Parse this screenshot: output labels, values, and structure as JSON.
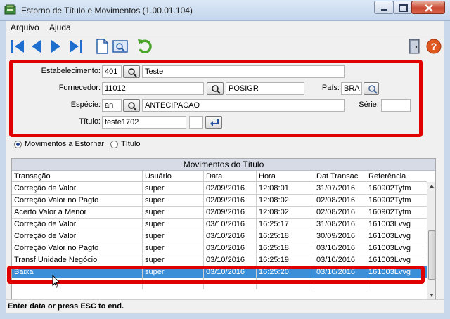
{
  "window": {
    "title": "Estorno de Título e Movimentos (1.00.01.104)"
  },
  "menu": [
    "Arquivo",
    "Ajuda"
  ],
  "toolbar": {
    "icons": [
      "first-record-icon",
      "previous-record-icon",
      "next-record-icon",
      "last-record-icon",
      "new-document-icon",
      "preview-icon",
      "refresh-icon",
      "exit-door-icon",
      "help-icon"
    ]
  },
  "form": {
    "estabelecimento": {
      "label": "Estabelecimento:",
      "code": "401",
      "desc": "Teste"
    },
    "fornecedor": {
      "label": "Fornecedor:",
      "code": "11012",
      "desc": "POSIGR"
    },
    "pais": {
      "label": "País:",
      "value": "BRA"
    },
    "especie": {
      "label": "Espécie:",
      "code": "an",
      "desc": "ANTECIPACAO"
    },
    "serie": {
      "label": "Série:",
      "value": ""
    },
    "titulo": {
      "label": "Título:",
      "value": "teste1702",
      "parcela": ""
    }
  },
  "radio": {
    "option1": "Movimentos a Estornar",
    "option2": "Título",
    "selected": "Movimentos a Estornar"
  },
  "grid": {
    "title": "Movimentos do Título",
    "columns": [
      "Transação",
      "Usuário",
      "Data",
      "Hora",
      "Dat Transac",
      "Referência"
    ],
    "rows": [
      [
        "Correção de Valor",
        "super",
        "02/09/2016",
        "12:08:01",
        "31/07/2016",
        "160902Tyfm"
      ],
      [
        "Correção Valor no Pagto",
        "super",
        "02/09/2016",
        "12:08:02",
        "02/08/2016",
        "160902Tyfm"
      ],
      [
        "Acerto Valor a Menor",
        "super",
        "02/09/2016",
        "12:08:02",
        "02/08/2016",
        "160902Tyfm"
      ],
      [
        "Correção de Valor",
        "super",
        "03/10/2016",
        "16:25:17",
        "31/08/2016",
        "161003Lvvg"
      ],
      [
        "Correção de Valor",
        "super",
        "03/10/2016",
        "16:25:18",
        "30/09/2016",
        "161003Lvvg"
      ],
      [
        "Correção Valor no Pagto",
        "super",
        "03/10/2016",
        "16:25:18",
        "03/10/2016",
        "161003Lvvg"
      ],
      [
        "Transf Unidade Negócio",
        "super",
        "03/10/2016",
        "16:25:19",
        "03/10/2016",
        "161003Lvvg"
      ],
      [
        "Baixa",
        "super",
        "03/10/2016",
        "16:25:20",
        "03/10/2016",
        "161003Lvvg"
      ]
    ],
    "selected_row": 7
  },
  "status": {
    "text": "Enter data or press ESC to end."
  },
  "colors": {
    "highlight_red": "#e10000",
    "selection_blue": "#3b8fd9",
    "title_bg": "#d6dbe6"
  }
}
